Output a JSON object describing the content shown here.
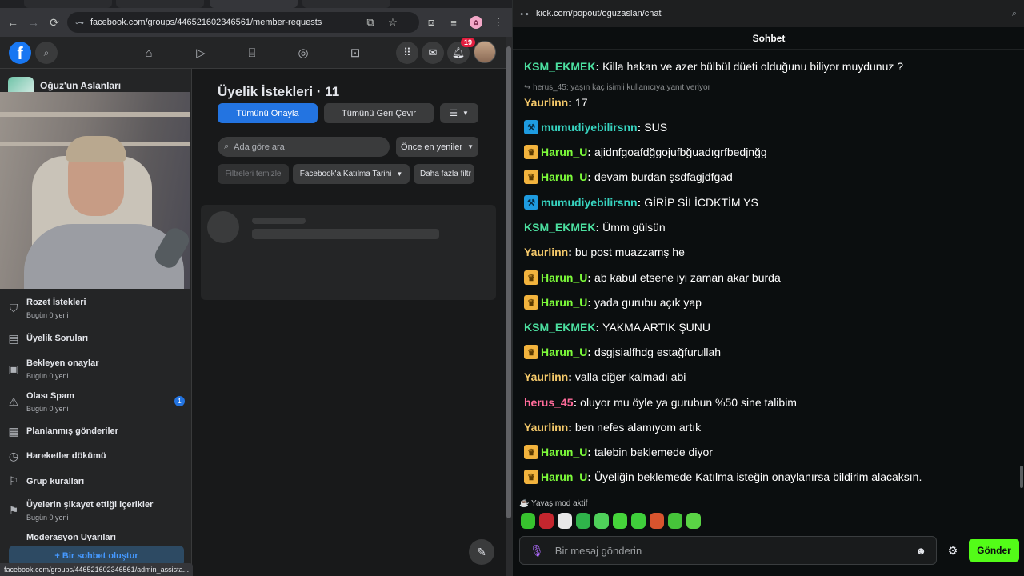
{
  "colors": {
    "fb_blue": "#2374e1",
    "kick_green": "#53fc18",
    "user_green": "#4ce0a0",
    "user_yellow": "#f5c96a",
    "user_lime": "#7dfc3a",
    "user_teal": "#37d4c0",
    "user_pink": "#ff6b9a"
  },
  "left_browser": {
    "address_url": "facebook.com/groups/446521602346561/member-requests",
    "notification_count": "19",
    "status_url": "facebook.com/groups/446521602346561/admin_assista..."
  },
  "facebook": {
    "group_name": "Oğuz'un Aslanları",
    "page_title": "Üyelik İstekleri · 11",
    "approve_all": "Tümünü Onayla",
    "decline_all": "Tümünü Geri Çevir",
    "search_placeholder": "Ada göre ara",
    "sort_label": "Önce en yeniler",
    "clear_filters": "Filtreleri temizle",
    "join_date_filter": "Facebook'a Katılma Tarihi",
    "more_filters": "Daha fazla filtr",
    "new_chat": "+ Bir sohbet oluştur",
    "menu": [
      {
        "title": "Rozet İstekleri",
        "sub": "Bugün 0 yeni",
        "icon": "badge-icon"
      },
      {
        "title": "Üyelik Soruları",
        "sub": "",
        "icon": "question-icon"
      },
      {
        "title": "Bekleyen onaylar",
        "sub": "Bugün 0 yeni",
        "icon": "pending-icon"
      },
      {
        "title": "Olası Spam",
        "sub": "Bugün 0 yeni",
        "icon": "warning-icon",
        "badge": "1"
      },
      {
        "title": "Planlanmış gönderiler",
        "sub": "",
        "icon": "calendar-icon"
      },
      {
        "title": "Hareketler dökümü",
        "sub": "",
        "icon": "clock-icon"
      },
      {
        "title": "Grup kuralları",
        "sub": "",
        "icon": "rules-icon"
      },
      {
        "title": "Üyelerin şikayet ettiği içerikler",
        "sub": "Bugün 0 yeni",
        "icon": "report-icon"
      },
      {
        "title": "Moderasyon Uyarıları",
        "sub": "",
        "icon": "alert-icon"
      }
    ]
  },
  "kick": {
    "url": "kick.com/popout/oguzaslan/chat",
    "header": "Sohbet",
    "reply_context": "↪ herus_45: yaşın kaç isimli kullanıcıya yanıt veriyor",
    "messages": [
      {
        "user": "KSM_EKMEK",
        "text": "Killa hakan ve azer bülbül düeti olduğunu biliyor muydunuz ?",
        "badge": "none",
        "color": "user_green"
      },
      {
        "user": "Yaurlinn",
        "text": "17",
        "badge": "none",
        "color": "user_yellow"
      },
      {
        "user": "mumudiyebilirsnn",
        "text": "SUS",
        "badge": "mod",
        "color": "user_teal"
      },
      {
        "user": "Harun_U",
        "text": "ajidnfgoafdğgojufbğuadıgrfbedjnğg",
        "badge": "crown",
        "color": "user_lime"
      },
      {
        "user": "Harun_U",
        "text": "devam burdan şsdfagjdfgad",
        "badge": "crown",
        "color": "user_lime"
      },
      {
        "user": "mumudiyebilirsnn",
        "text": "GİRİP SİLİCDKTİM YS",
        "badge": "mod",
        "color": "user_teal"
      },
      {
        "user": "KSM_EKMEK",
        "text": "Ümm gülsün",
        "badge": "none",
        "color": "user_green"
      },
      {
        "user": "Yaurlinn",
        "text": "bu post muazzamş he",
        "badge": "none",
        "color": "user_yellow"
      },
      {
        "user": "Harun_U",
        "text": "ab kabul etsene iyi zaman akar burda",
        "badge": "crown",
        "color": "user_lime"
      },
      {
        "user": "Harun_U",
        "text": "yada gurubu açık yap",
        "badge": "crown",
        "color": "user_lime"
      },
      {
        "user": "KSM_EKMEK",
        "text": "YAKMA ARTIK ŞUNU",
        "badge": "none",
        "color": "user_green"
      },
      {
        "user": "Harun_U",
        "text": "dsgjsialfhdg estağfurullah",
        "badge": "crown",
        "color": "user_lime"
      },
      {
        "user": "Yaurlinn",
        "text": "valla ciğer kalmadı abi",
        "badge": "none",
        "color": "user_yellow"
      },
      {
        "user": "herus_45",
        "text": "oluyor mu öyle ya gurubun %50 sine talibim",
        "badge": "none",
        "color": "user_pink"
      },
      {
        "user": "Yaurlinn",
        "text": "ben nefes alamıyom artık",
        "badge": "none",
        "color": "user_yellow"
      },
      {
        "user": "Harun_U",
        "text": "talebin beklemede diyor",
        "badge": "crown",
        "color": "user_lime"
      },
      {
        "user": "Harun_U",
        "text": "Üyeliğin beklemede Katılma isteğin onaylanırsa bildirim alacaksın.",
        "badge": "crown",
        "color": "user_lime"
      }
    ],
    "slow_mode": "☕ Yavaş mod aktif",
    "input_placeholder": "Bir mesaj gönderin",
    "send_label": "Gönder"
  }
}
